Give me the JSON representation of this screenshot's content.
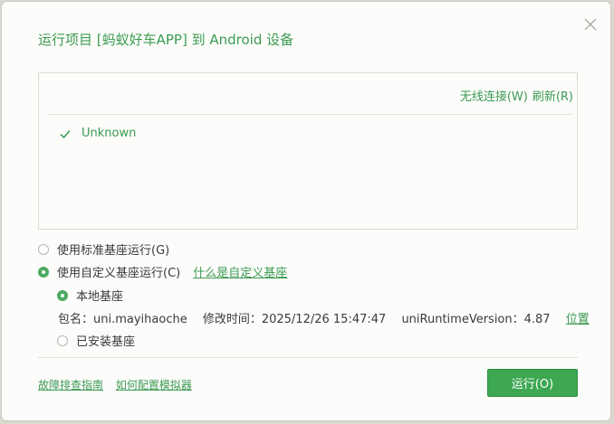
{
  "dialog": {
    "title": "运行项目 [蚂蚁好车APP] 到 Android 设备",
    "close_icon": "close-icon"
  },
  "device_list": {
    "wireless_connect": "无线连接(W)",
    "refresh": "刷新(R)",
    "devices": [
      {
        "name": "Unknown",
        "checked": true
      }
    ]
  },
  "base_options": {
    "standard": {
      "label": "使用标准基座运行(G)",
      "selected": false
    },
    "custom": {
      "label": "使用自定义基座运行(C)",
      "selected": true,
      "help_link": "什么是自定义基座"
    }
  },
  "custom_base": {
    "local": {
      "label": "本地基座",
      "selected": true
    },
    "info": {
      "package": "包名：uni.mayihaoche",
      "modified": "修改时间：2025/12/26 15:47:47",
      "runtime_version": "uniRuntimeVersion：4.87",
      "location_link": "位置"
    },
    "installed": {
      "label": "已安装基座",
      "selected": false
    }
  },
  "footer": {
    "troubleshoot_link": "故障排查指南",
    "emulator_link": "如何配置模拟器",
    "run_button": "运行(O)"
  },
  "colors": {
    "accent": "#3c9a52",
    "button": "#3da752"
  }
}
